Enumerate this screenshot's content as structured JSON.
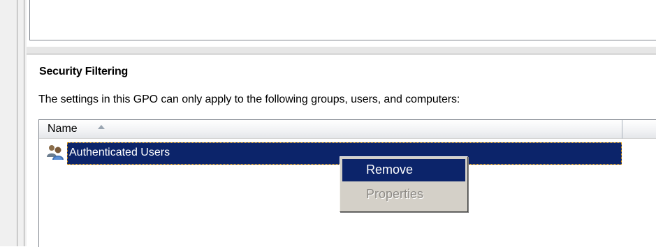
{
  "section": {
    "title": "Security Filtering",
    "description": "The settings in this GPO can only apply to the following groups, users, and computers:"
  },
  "list": {
    "columns": [
      {
        "label": "Name",
        "sort": "ascending"
      }
    ],
    "rows": [
      {
        "name": "Authenticated Users",
        "icon": "users-group-icon",
        "selected": true
      }
    ]
  },
  "context_menu": {
    "items": [
      {
        "label": "Remove",
        "state": "highlighted"
      },
      {
        "label": "Properties",
        "state": "disabled"
      }
    ]
  },
  "colors": {
    "selection": "#0c246a",
    "menu_background": "#d4d0c8",
    "disabled_text": "#8d8a85"
  }
}
